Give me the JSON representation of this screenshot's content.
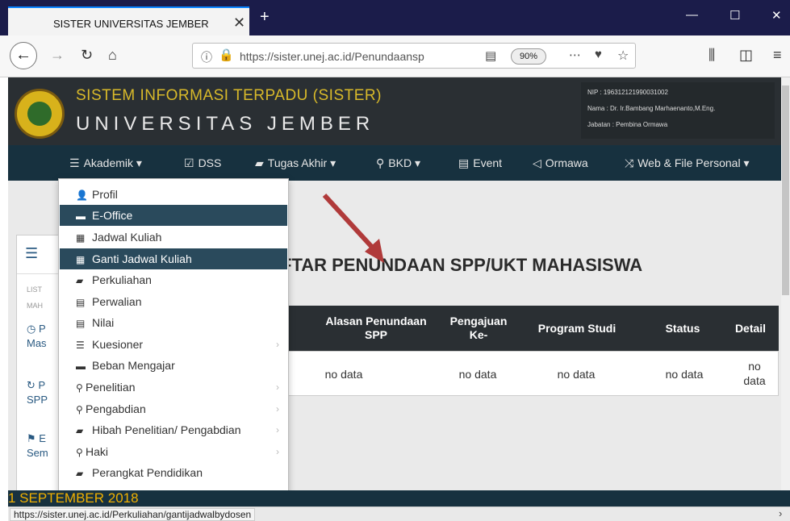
{
  "browser": {
    "tab_title": "SISTER UNIVERSITAS JEMBER",
    "url": "https://sister.unej.ac.id/Penundaansp",
    "zoom": "90%"
  },
  "header": {
    "title": "SISTEM INFORMASI TERPADU (SISTER)",
    "subtitle": "UNIVERSITAS JEMBER",
    "nip": "NIP    : 196312121990031002",
    "nama": "Nama   : Dr. Ir.Bambang Marhaenanto,M.Eng.",
    "jabatan": "Jabatan : Pembina Ormawa"
  },
  "menu": [
    {
      "label": "Akademik ▾",
      "icon": "list-icon"
    },
    {
      "label": "DSS",
      "icon": "check-icon"
    },
    {
      "label": "Tugas Akhir ▾",
      "icon": "book-icon"
    },
    {
      "label": "BKD ▾",
      "icon": "search-icon"
    },
    {
      "label": "Event",
      "icon": "calendar-icon"
    },
    {
      "label": "Ormawa",
      "icon": "megaphone-icon"
    },
    {
      "label": "Web & File Personal ▾",
      "icon": "shuffle-icon"
    }
  ],
  "dropdown": [
    {
      "label": "Profil",
      "icon": "user-icon"
    },
    {
      "label": "E-Office",
      "icon": "briefcase-icon"
    },
    {
      "label": "Jadwal Kuliah",
      "icon": "calendar-icon"
    },
    {
      "label": "Ganti Jadwal Kuliah",
      "icon": "calendar-icon"
    },
    {
      "label": "Perkuliahan",
      "icon": "book-icon"
    },
    {
      "label": "Perwalian",
      "icon": "card-icon"
    },
    {
      "label": "Nilai",
      "icon": "card-icon"
    },
    {
      "label": "Kuesioner",
      "icon": "list-icon"
    },
    {
      "label": "Beban Mengajar",
      "icon": "briefcase-icon"
    },
    {
      "label": "Penelitian",
      "icon": "marker-icon"
    },
    {
      "label": "Pengabdian",
      "icon": "marker-icon"
    },
    {
      "label": "Hibah Penelitian/ Pengabdian",
      "icon": "book-icon"
    },
    {
      "label": "Haki",
      "icon": "marker-icon"
    },
    {
      "label": "Perangkat Pendidikan",
      "icon": "book-icon"
    }
  ],
  "sidebar": {
    "list_label": "LIST",
    "list_label2": "MAH",
    "items": [
      "P",
      "Mas",
      "P",
      "SPP",
      "E",
      "Sem"
    ]
  },
  "main": {
    "title": "FTAR PENUNDAAN SPP/UKT MAHASISWA",
    "columns": [
      "Alasan Penundaan SPP",
      "Pengajuan Ke-",
      "Program Studi",
      "Status",
      "Detail"
    ],
    "row": [
      "no data",
      "no data",
      "no data",
      "no data",
      "no data"
    ]
  },
  "footer": {
    "date": "1 SEPTEMBER 2018",
    "status_url": "https://sister.unej.ac.id/Perkuliahan/gantijadwalbydosen"
  }
}
